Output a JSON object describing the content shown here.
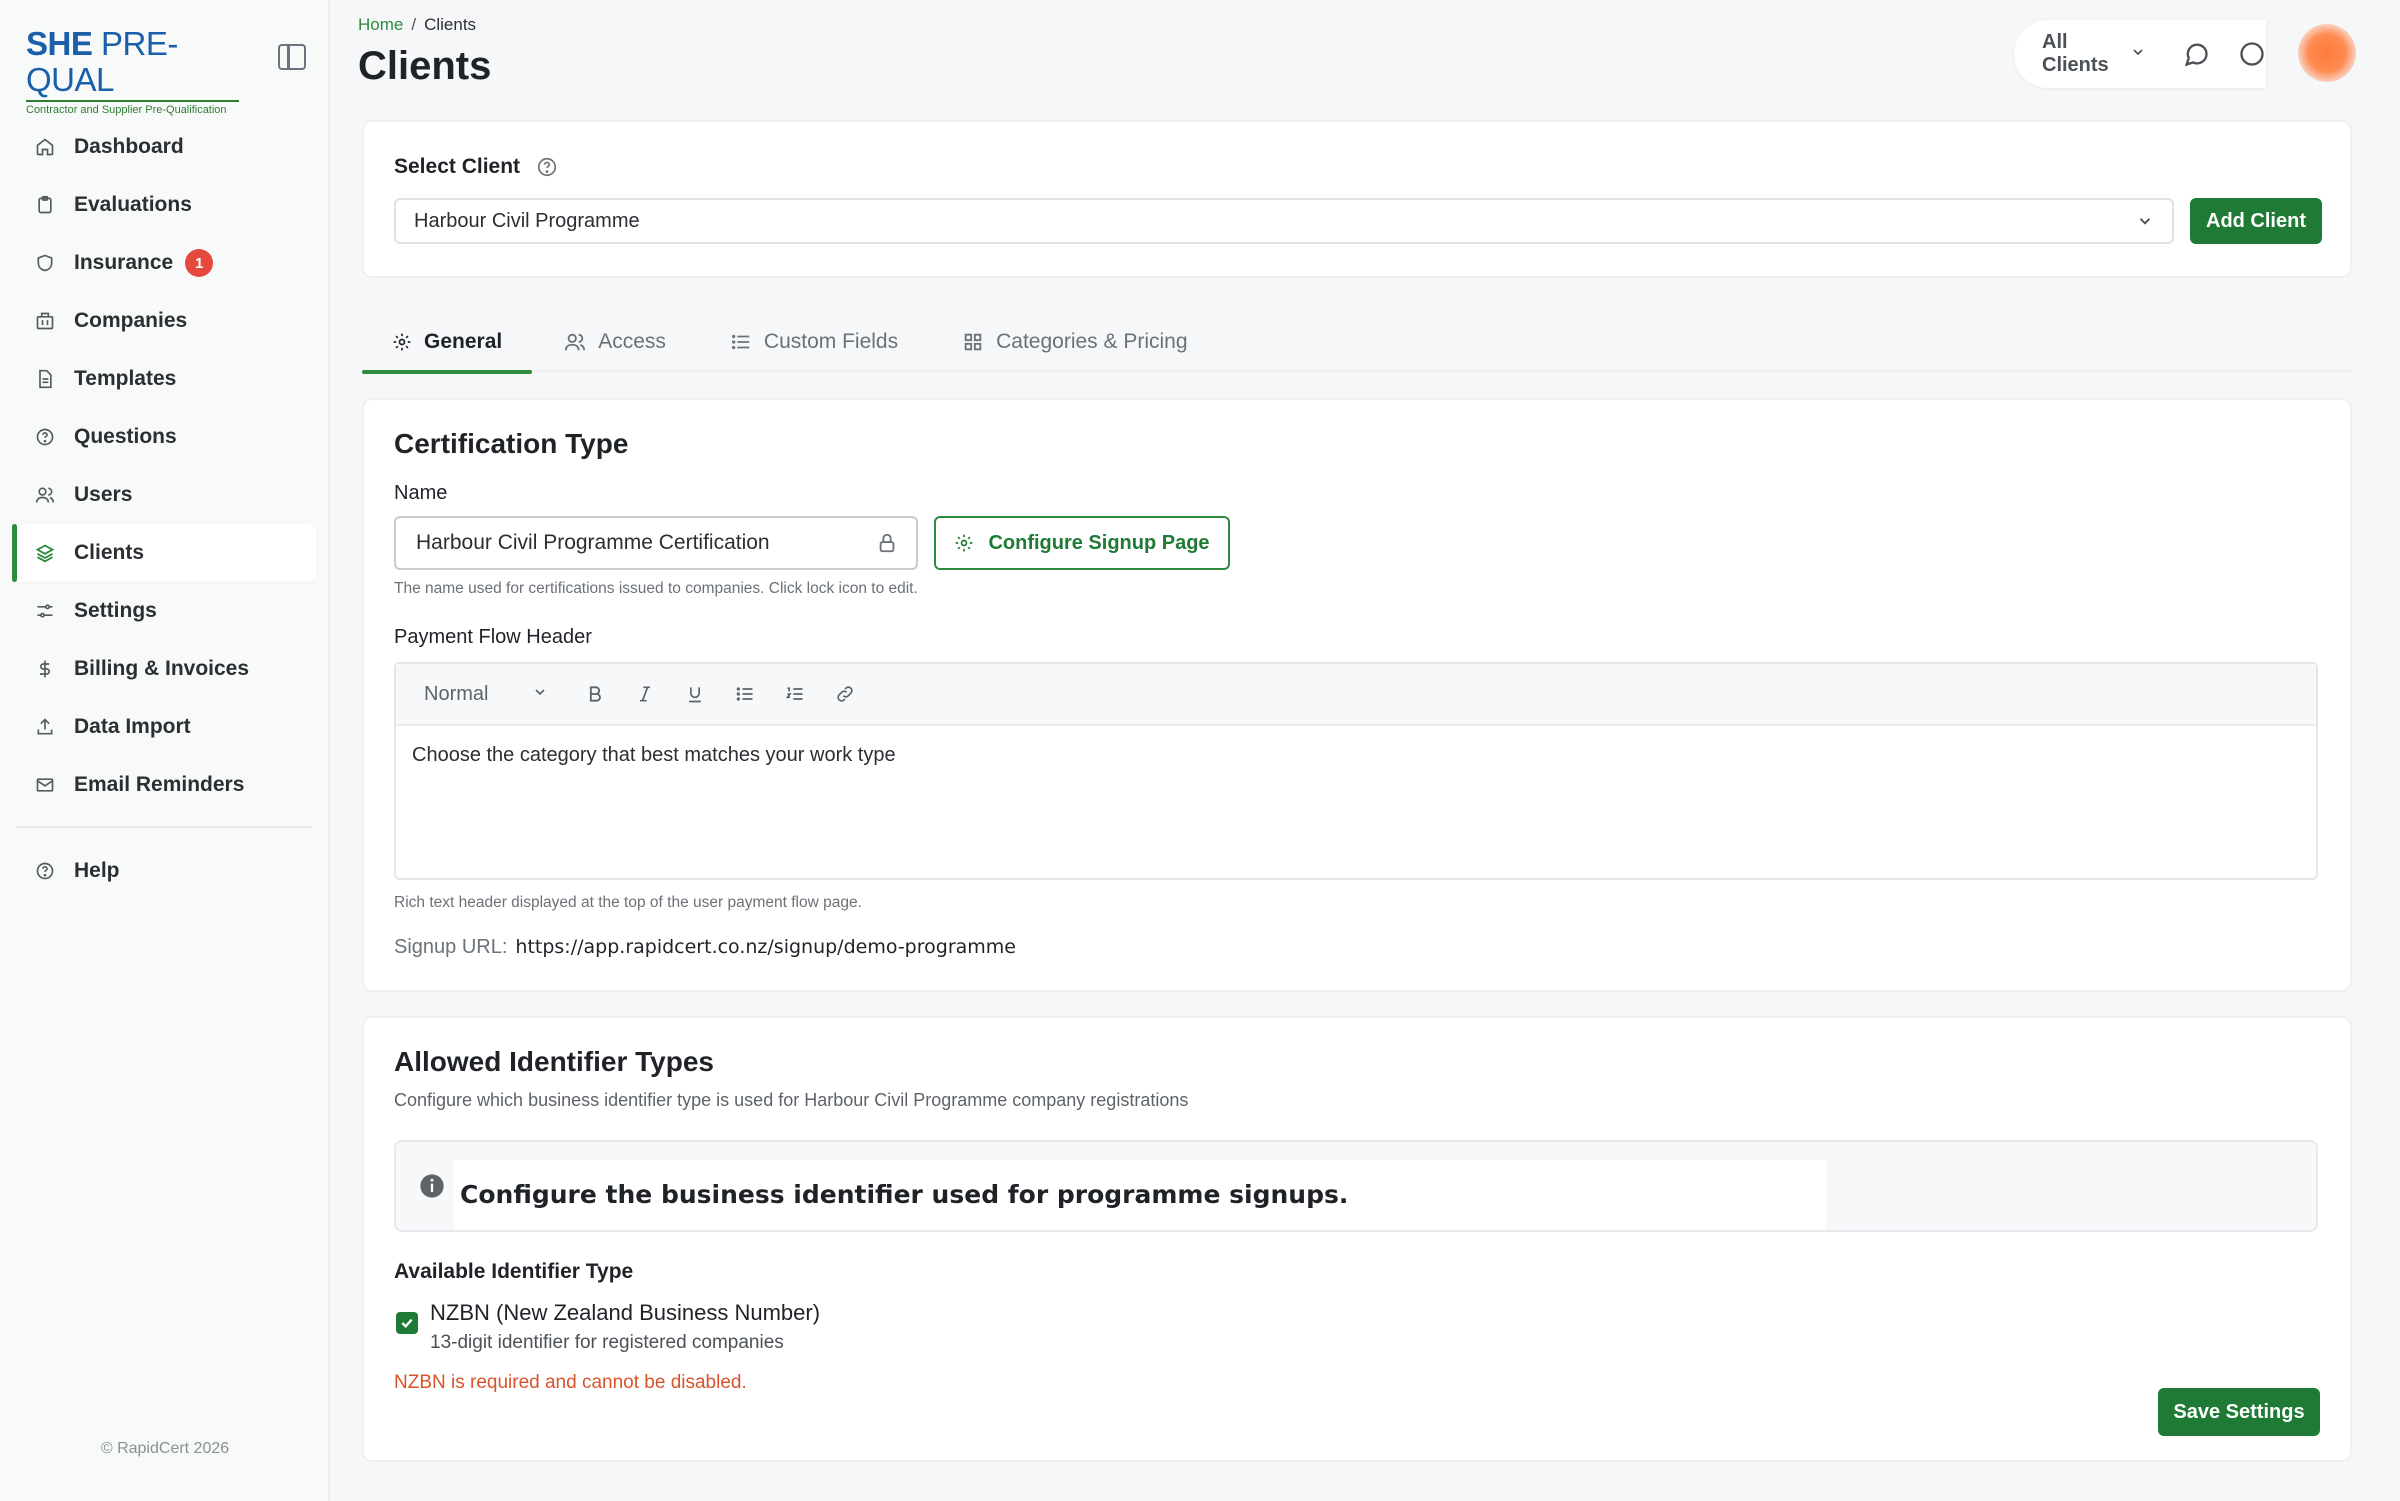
{
  "brand": {
    "name_bold": "SHE",
    "name_light": "PRE-QUAL",
    "tagline": "Contractor and Supplier Pre-Qualification"
  },
  "sidebar": {
    "items": [
      {
        "label": "Dashboard",
        "icon": "home-icon"
      },
      {
        "label": "Evaluations",
        "icon": "clipboard-icon"
      },
      {
        "label": "Insurance",
        "icon": "shield-icon",
        "badge": "1"
      },
      {
        "label": "Companies",
        "icon": "building-icon"
      },
      {
        "label": "Templates",
        "icon": "file-icon"
      },
      {
        "label": "Questions",
        "icon": "question-icon"
      },
      {
        "label": "Users",
        "icon": "users-icon"
      },
      {
        "label": "Clients",
        "icon": "layers-icon",
        "active": true
      },
      {
        "label": "Settings",
        "icon": "sliders-icon"
      },
      {
        "label": "Billing & Invoices",
        "icon": "dollar-icon"
      },
      {
        "label": "Data Import",
        "icon": "upload-icon"
      },
      {
        "label": "Email Reminders",
        "icon": "mail-icon"
      }
    ],
    "help_label": "Help",
    "copyright": "© RapidCert 2026"
  },
  "breadcrumb": {
    "home": "Home",
    "separator": "/",
    "current": "Clients"
  },
  "page_title": "Clients",
  "topbar": {
    "client_filter": "All Clients"
  },
  "select_client": {
    "label": "Select Client",
    "value": "Harbour Civil Programme",
    "add_button": "Add Client"
  },
  "tabs": [
    {
      "label": "General",
      "active": true
    },
    {
      "label": "Access"
    },
    {
      "label": "Custom Fields"
    },
    {
      "label": "Categories & Pricing"
    }
  ],
  "certification": {
    "title": "Certification Type",
    "name_label": "Name",
    "name_value": "Harbour Civil Programme Certification",
    "configure_button": "Configure Signup Page",
    "name_hint": "The name used for certifications issued to companies. Click lock icon to edit.",
    "payment_header_label": "Payment Flow Header",
    "editor_format": "Normal",
    "editor_content": "Choose the category that best matches your work type",
    "editor_hint": "Rich text header displayed at the top of the user payment flow page.",
    "signup_url_label": "Signup URL:",
    "signup_url": "https://app.rapidcert.co.nz/signup/demo-programme"
  },
  "identifiers": {
    "title": "Allowed Identifier Types",
    "subtitle": "Configure which business identifier type is used for Harbour Civil Programme company registrations",
    "info_message": "Configure the business identifier used for programme signups.",
    "available_label": "Available Identifier Type",
    "option_title": "NZBN (New Zealand Business Number)",
    "option_desc": "13-digit identifier for registered companies",
    "option_checked": true,
    "warning": "NZBN is required and cannot be disabled.",
    "save_button": "Save Settings"
  },
  "colors": {
    "accent": "#1e7a34",
    "badge": "#e5483d",
    "warning": "#d9542b",
    "brand_blue": "#1b5faa"
  }
}
